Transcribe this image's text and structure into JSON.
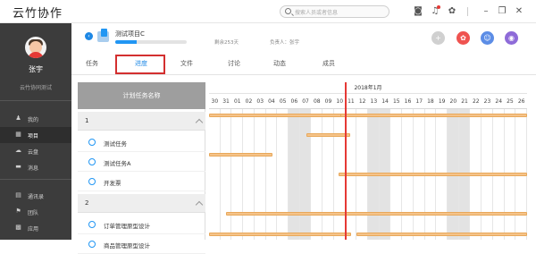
{
  "app": {
    "title": "云竹协作"
  },
  "search": {
    "placeholder": "搜索人员或者信息"
  },
  "user": {
    "name": "张宇",
    "company": "云竹协同测试"
  },
  "nav": {
    "items": [
      {
        "label": "我的",
        "icon": "person-icon",
        "active": false
      },
      {
        "label": "项目",
        "icon": "grid-icon",
        "active": true
      },
      {
        "label": "云盘",
        "icon": "cloud-icon",
        "active": false
      },
      {
        "label": "消息",
        "icon": "chat-icon",
        "active": false
      },
      {
        "label": "通讯录",
        "icon": "contacts-icon",
        "active": false
      },
      {
        "label": "团队",
        "icon": "flag-icon",
        "active": false
      },
      {
        "label": "应用",
        "icon": "apps-icon",
        "active": false
      }
    ]
  },
  "project": {
    "name": "测试项目C",
    "progress": 0.3,
    "remaining": "剩余253天",
    "owner": "负责人：张宇"
  },
  "tabs": [
    {
      "label": "任务",
      "active": false
    },
    {
      "label": "进度",
      "active": true
    },
    {
      "label": "文件",
      "active": false
    },
    {
      "label": "讨论",
      "active": false
    },
    {
      "label": "动态",
      "active": false
    },
    {
      "label": "成员",
      "active": false
    }
  ],
  "tasklist": {
    "header": "计划任务名称",
    "groups": [
      {
        "name": "1",
        "tasks": [
          "测试任务",
          "测试任务A",
          "开发票"
        ]
      },
      {
        "name": "2",
        "tasks": [
          "订单管理原型设计",
          "商品管理原型设计"
        ]
      }
    ]
  },
  "gantt": {
    "month": "2018年1月",
    "days": [
      "30",
      "31",
      "01",
      "02",
      "03",
      "04",
      "05",
      "06",
      "07",
      "08",
      "09",
      "10",
      "11",
      "12",
      "13",
      "14",
      "15",
      "16",
      "17",
      "18",
      "19",
      "20",
      "21",
      "22",
      "23",
      "24",
      "25",
      "26"
    ],
    "weekend_indices": [
      7,
      8,
      14,
      15,
      21,
      22
    ],
    "today_index": 12
  },
  "colors": {
    "accent": "#1e88e5",
    "sidebar": "#3c3c3c",
    "today": "#e53935",
    "bar": "#f5c389",
    "highlight": "#d32f2f",
    "btn_add": "#d0d0d0",
    "btn_red": "#ef5350",
    "btn_blue": "#5c8de6",
    "btn_purple": "#8e6bd8"
  }
}
